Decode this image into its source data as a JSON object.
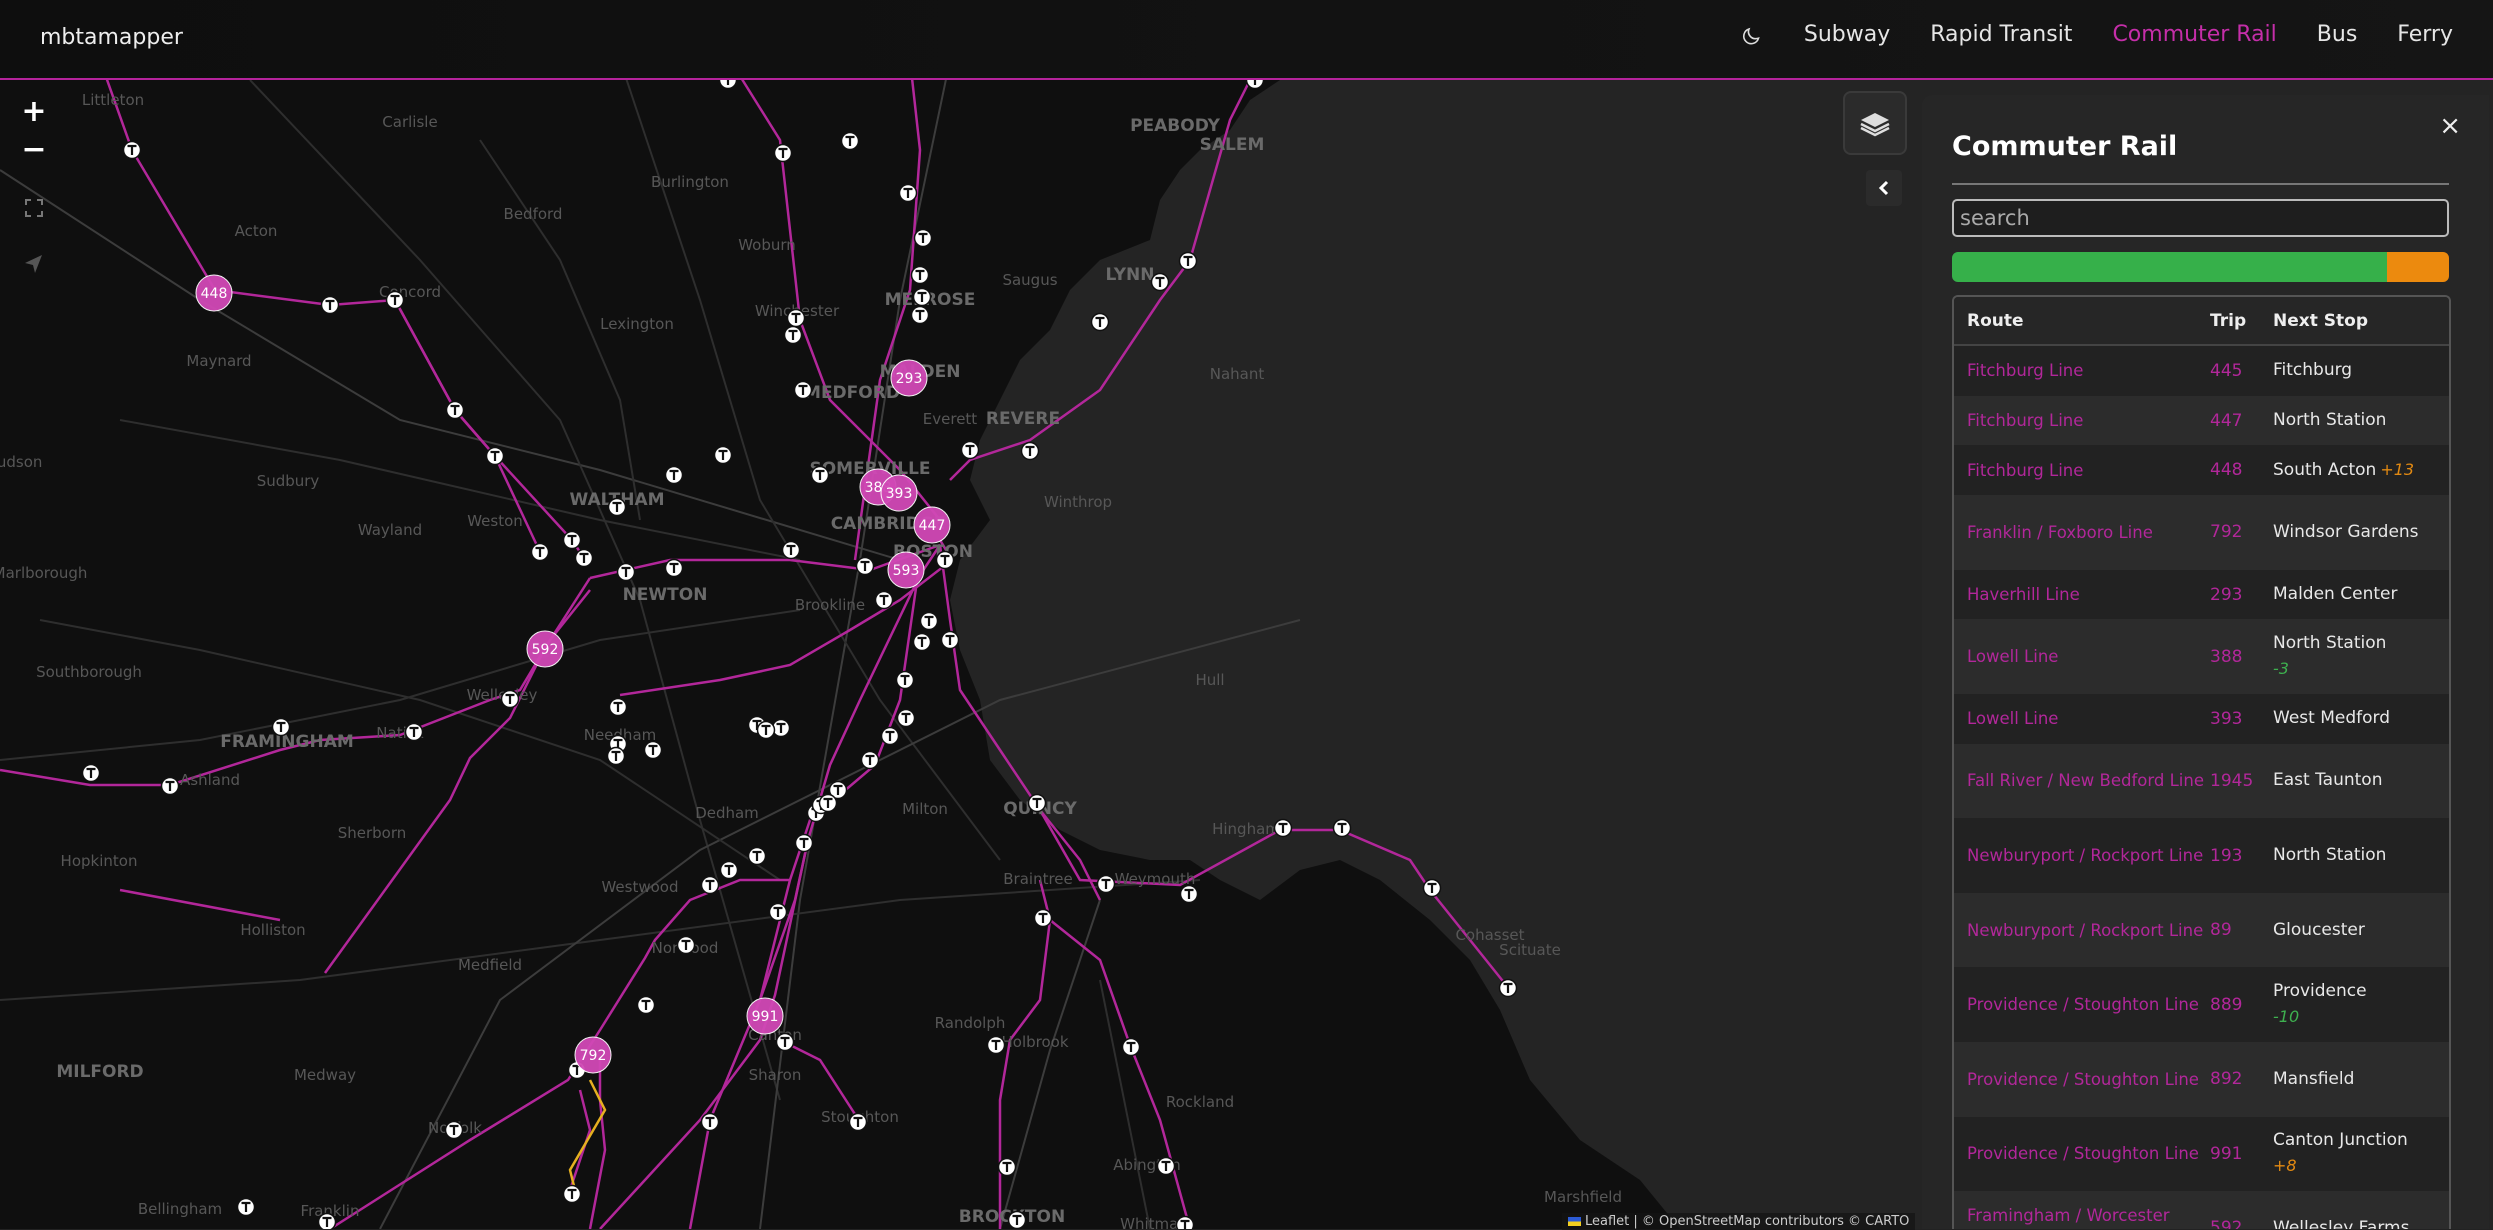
{
  "app": {
    "brand": "mbtamapper",
    "nav": [
      {
        "label": "Subway",
        "active": false
      },
      {
        "label": "Rapid Transit",
        "active": false
      },
      {
        "label": "Commuter Rail",
        "active": true
      },
      {
        "label": "Bus",
        "active": false
      },
      {
        "label": "Ferry",
        "active": false
      }
    ],
    "theme_icon": "moon-icon",
    "accent_color": "#c52ea9"
  },
  "map": {
    "zoom_in": "+",
    "zoom_out": "−",
    "controls": [
      "fullscreen-icon",
      "locate-icon",
      "layers-icon",
      "chevron-left-icon"
    ],
    "attribution_prefix": "Leaflet",
    "attribution": " | © OpenStreetMap contributors © CARTO",
    "towns": [
      "Littleton",
      "Carlisle",
      "Burlington",
      "Bedford",
      "PEABODY",
      "SALEM",
      "Woburn",
      "Acton",
      "Saugus",
      "LYNN",
      "Concord",
      "Lexington",
      "MELROSE",
      "Winchester",
      "Maynard",
      "MALDEN",
      "Nahant",
      "MEDFORD",
      "Everett",
      "REVERE",
      "Hudson",
      "Sudbury",
      "SOMERVILLE",
      "WALTHAM",
      "Winthrop",
      "Weston",
      "CAMBRIDGE",
      "Wayland",
      "BOSTON",
      "Marlborough",
      "NEWTON",
      "Brookline",
      "Hull",
      "Southborough",
      "Wellesley",
      "Needham",
      "FRAMINGHAM",
      "Natick",
      "Ashland",
      "Dedham",
      "Milton",
      "QUINCY",
      "Sherborn",
      "Hingham",
      "Hopkinton",
      "Westwood",
      "Braintree",
      "Weymouth",
      "Holliston",
      "Norwood",
      "Cohasset",
      "Scituate",
      "Medfield",
      "Randolph",
      "Holbrook",
      "MILFORD",
      "Medway",
      "Canton",
      "Stoughton",
      "Rockland",
      "Norfolk",
      "Sharon",
      "Abington",
      "Bellingham",
      "Franklin",
      "Marshfield",
      "BROCKTON",
      "Whitman"
    ],
    "train_markers": [
      {
        "trip": "448",
        "route": "Fitchburg Line"
      },
      {
        "trip": "293",
        "route": "Haverhill Line"
      },
      {
        "trip": "388",
        "route": "Lowell Line"
      },
      {
        "trip": "393",
        "route": "Lowell Line"
      },
      {
        "trip": "447",
        "route": "Fitchburg Line"
      },
      {
        "trip": "593",
        "route": "Framingham / Worcester Line"
      },
      {
        "trip": "592",
        "route": "Framingham / Worcester Line"
      },
      {
        "trip": "991",
        "route": "Providence / Stoughton Line"
      },
      {
        "trip": "792",
        "route": "Franklin / Foxboro Line"
      }
    ]
  },
  "panel": {
    "title": "Commuter Rail",
    "close": "×",
    "search_placeholder": "search",
    "status": [
      {
        "label": "on-time",
        "fraction": 0.875,
        "color": "#36b04a"
      },
      {
        "label": "late",
        "fraction": 0.125,
        "color": "#ec8a0e"
      }
    ],
    "columns": {
      "route": "Route",
      "trip": "Trip",
      "next_stop": "Next Stop"
    },
    "rows": [
      {
        "route": "Fitchburg Line",
        "trip": "445",
        "next_stop": "Fitchburg",
        "delta": ""
      },
      {
        "route": "Fitchburg Line",
        "trip": "447",
        "next_stop": "North Station",
        "delta": ""
      },
      {
        "route": "Fitchburg Line",
        "trip": "448",
        "next_stop": "South Acton",
        "delta": "+13"
      },
      {
        "route": "Franklin / Foxboro Line",
        "trip": "792",
        "next_stop": "Windsor Gardens",
        "delta": ""
      },
      {
        "route": "Haverhill Line",
        "trip": "293",
        "next_stop": "Malden Center",
        "delta": ""
      },
      {
        "route": "Lowell Line",
        "trip": "388",
        "next_stop": "North Station",
        "delta": "-3"
      },
      {
        "route": "Lowell Line",
        "trip": "393",
        "next_stop": "West Medford",
        "delta": ""
      },
      {
        "route": "Fall River / New Bedford Line",
        "trip": "1945",
        "next_stop": "East Taunton",
        "delta": ""
      },
      {
        "route": "Newburyport / Rockport Line",
        "trip": "193",
        "next_stop": "North Station",
        "delta": ""
      },
      {
        "route": "Newburyport / Rockport Line",
        "trip": "89",
        "next_stop": "Gloucester",
        "delta": ""
      },
      {
        "route": "Providence / Stoughton Line",
        "trip": "889",
        "next_stop": "Providence",
        "delta": "-10"
      },
      {
        "route": "Providence / Stoughton Line",
        "trip": "892",
        "next_stop": "Mansfield",
        "delta": ""
      },
      {
        "route": "Providence / Stoughton Line",
        "trip": "991",
        "next_stop": "Canton Junction",
        "delta": "+8"
      },
      {
        "route": "Framingham / Worcester Line",
        "trip": "592",
        "next_stop": "Wellesley Farms",
        "delta": ""
      }
    ]
  }
}
